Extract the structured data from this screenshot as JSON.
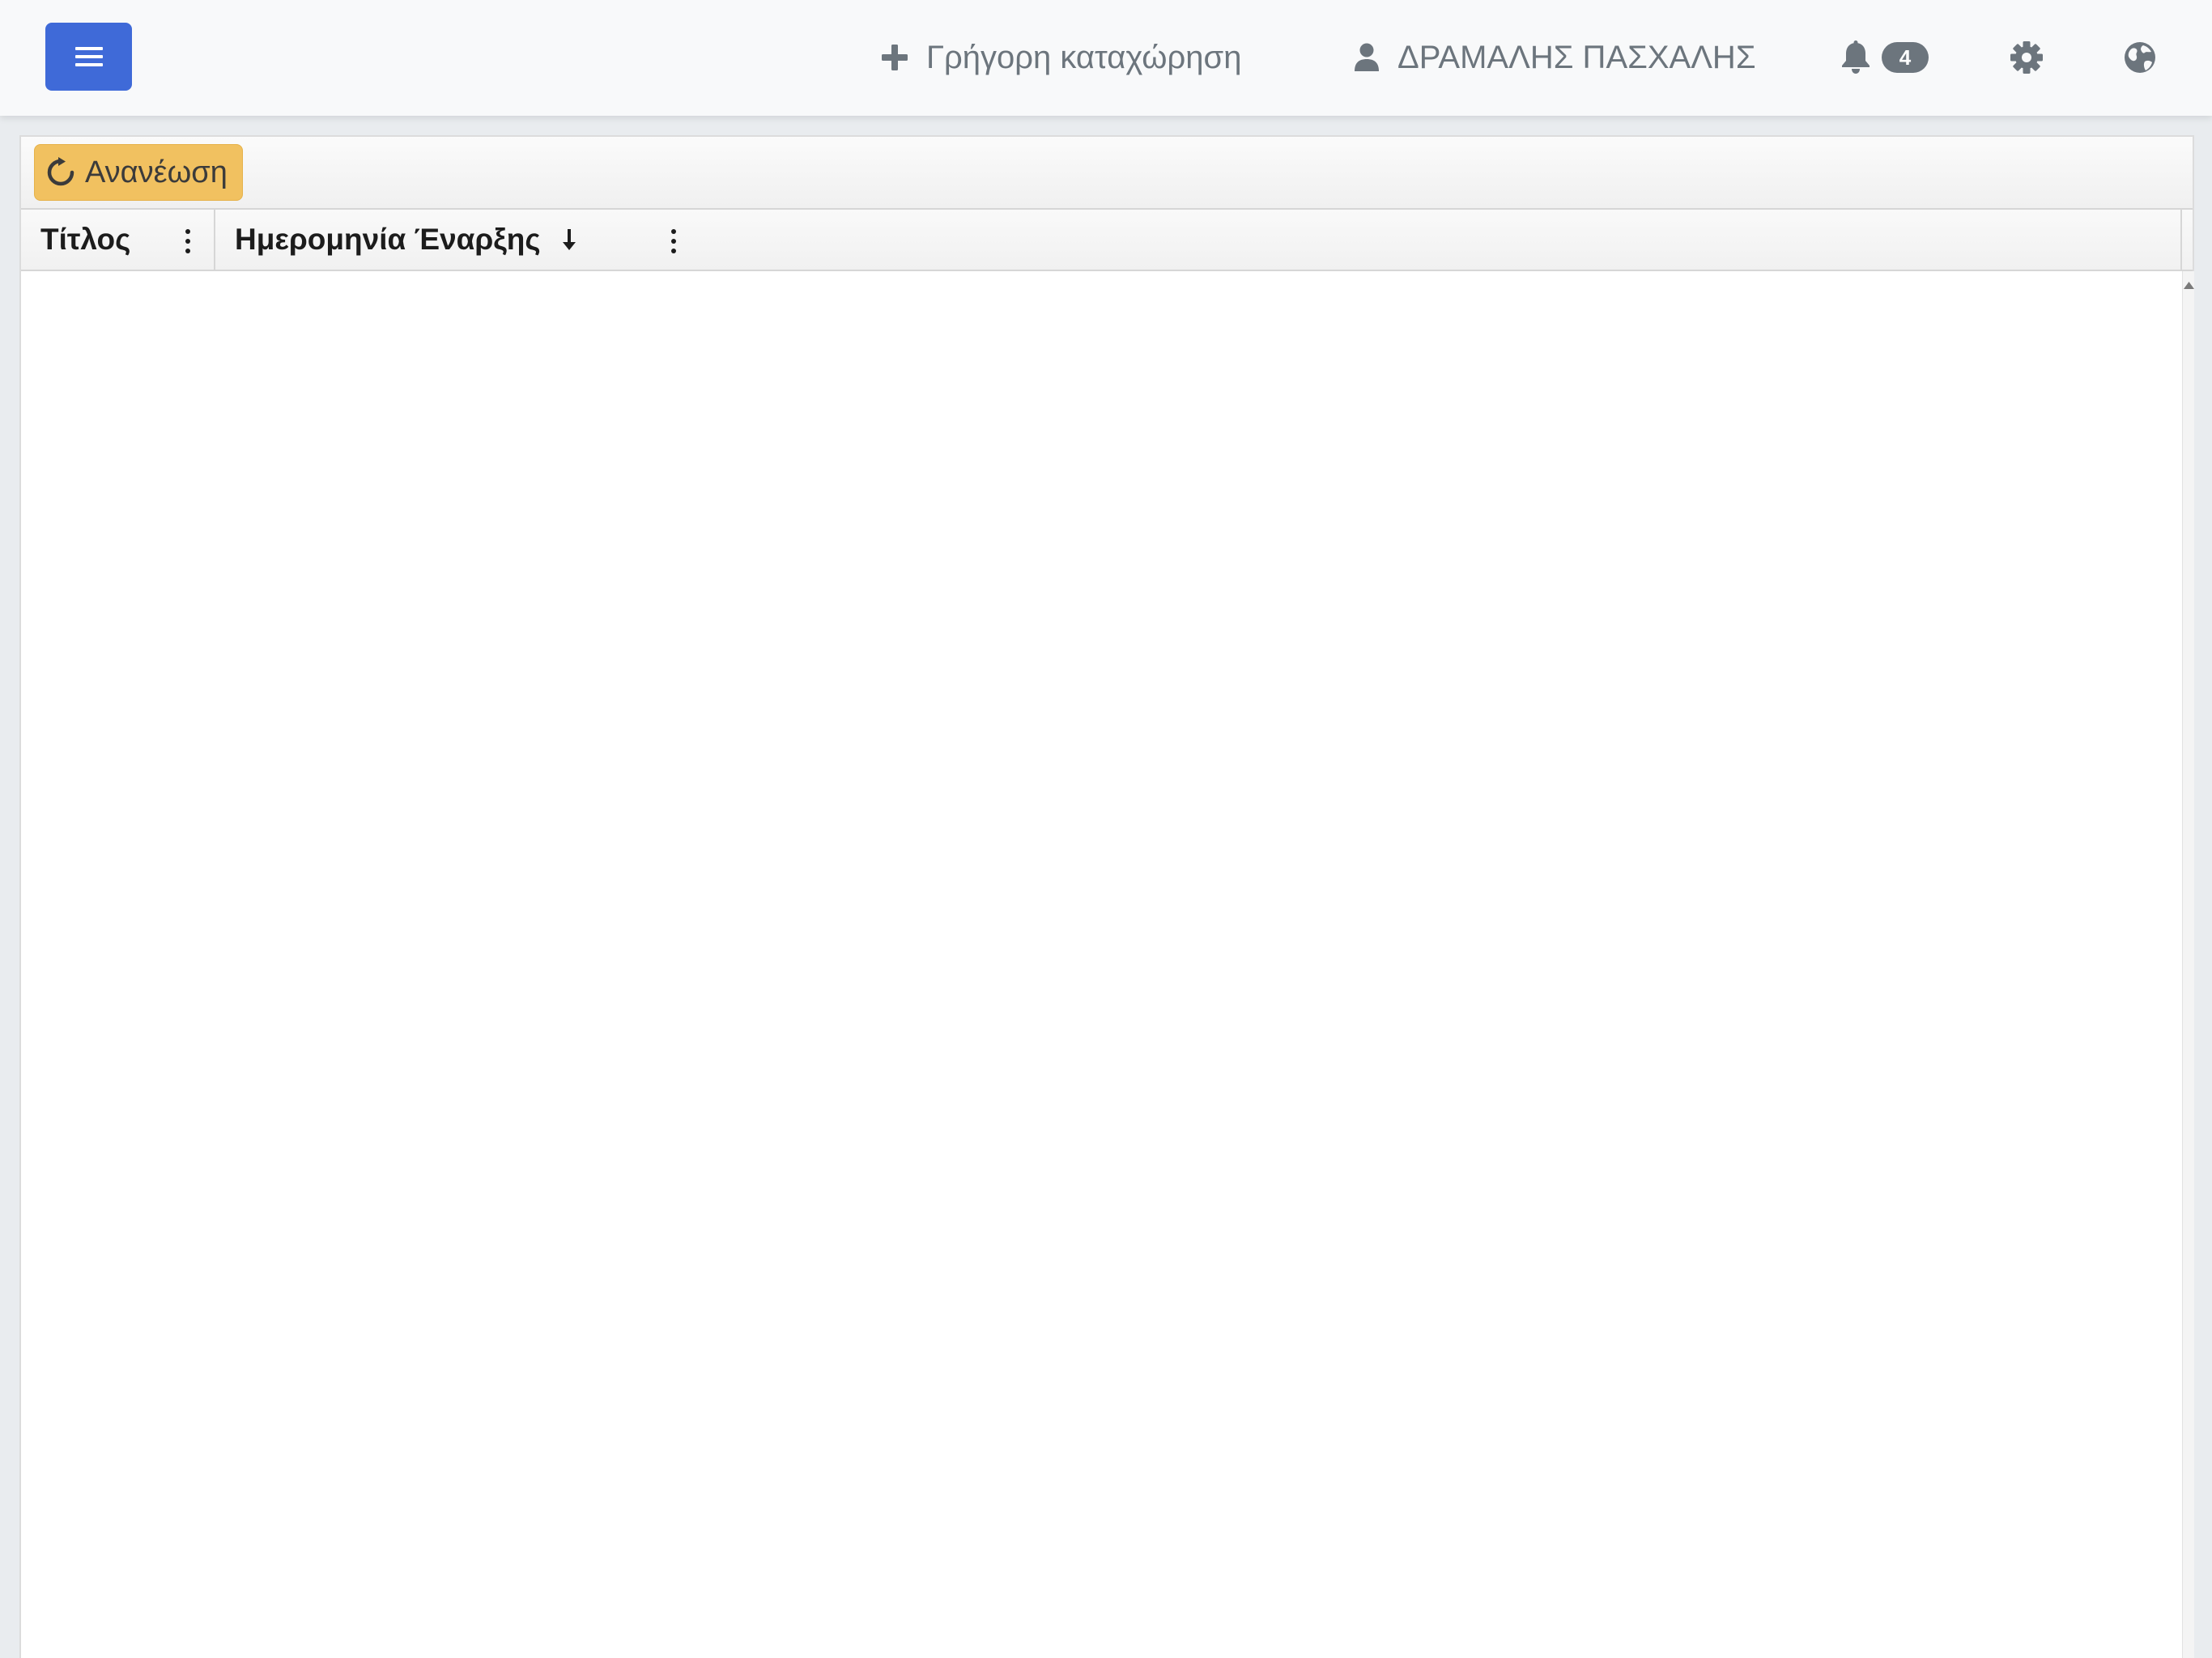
{
  "navbar": {
    "quick_entry_label": "Γρήγορη καταχώρηση",
    "user_name": "ΔΡΑΜΑΛΗΣ ΠΑΣΧΑΛΗΣ",
    "notification_count": "4",
    "icons": {
      "menu": "hamburger-icon",
      "quick_entry": "plus-icon",
      "user": "user-icon",
      "notifications": "bell-icon",
      "settings": "gear-icon",
      "language": "globe-icon"
    }
  },
  "grid": {
    "toolbar": {
      "refresh_label": "Ανανέωση",
      "refresh_icon": "refresh-icon"
    },
    "columns": [
      {
        "label": "Τίτλος"
      },
      {
        "label": "Ημερομηνία Έναρξης",
        "sort": "descending"
      }
    ],
    "rows": []
  },
  "colors": {
    "primary": "#3f6ad8",
    "warning": "#f1c160",
    "badge": "#6c757d",
    "nav_text": "#6c757d"
  }
}
